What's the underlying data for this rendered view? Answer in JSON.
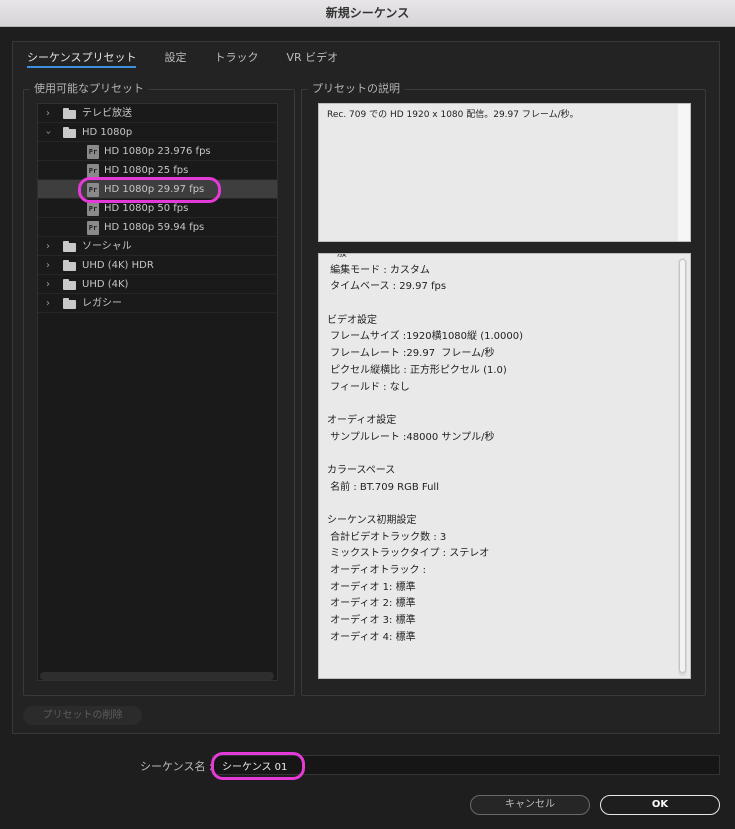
{
  "window": {
    "title": "新規シーケンス"
  },
  "tabs": [
    {
      "label": "シーケンスプリセット",
      "active": true
    },
    {
      "label": "設定",
      "active": false
    },
    {
      "label": "トラック",
      "active": false
    },
    {
      "label": "VR ビデオ",
      "active": false
    }
  ],
  "presets": {
    "group_label": "使用可能なプリセット",
    "tree": [
      {
        "label": "テレビ放送",
        "kind": "folder",
        "expanded": false
      },
      {
        "label": "HD 1080p",
        "kind": "folder",
        "expanded": true
      },
      {
        "label": "HD 1080p 23.976 fps",
        "kind": "preset"
      },
      {
        "label": "HD 1080p 25 fps",
        "kind": "preset"
      },
      {
        "label": "HD 1080p 29.97 fps",
        "kind": "preset",
        "selected": true
      },
      {
        "label": "HD 1080p 50 fps",
        "kind": "preset"
      },
      {
        "label": "HD 1080p 59.94 fps",
        "kind": "preset"
      },
      {
        "label": "ソーシャル",
        "kind": "folder",
        "expanded": false
      },
      {
        "label": "UHD (4K) HDR",
        "kind": "folder",
        "expanded": false
      },
      {
        "label": "UHD (4K)",
        "kind": "folder",
        "expanded": false
      },
      {
        "label": "レガシー",
        "kind": "folder",
        "expanded": false
      }
    ],
    "preset_icon_text": "Pr"
  },
  "description": {
    "group_label": "プリセットの説明",
    "text": "Rec. 709 での HD 1920 x 1080 配信。29.97 フレーム/秒。"
  },
  "details": {
    "lines": [
      "一般",
      " 編集モード : カスタム",
      " タイムベース : 29.97 fps",
      "",
      "ビデオ設定",
      " フレームサイズ :1920横1080縦 (1.0000)",
      " フレームレート :29.97  フレーム/秒",
      " ピクセル縦横比 : 正方形ピクセル (1.0)",
      " フィールド : なし",
      "",
      "オーディオ設定",
      " サンプルレート :48000 サンプル/秒",
      "",
      "カラースペース",
      " 名前 : BT.709 RGB Full",
      "",
      "シーケンス初期設定",
      " 合計ビデオトラック数 : 3",
      " ミックストラックタイプ : ステレオ",
      " オーディオトラック :",
      " オーディオ 1: 標準",
      " オーディオ 2: 標準",
      " オーディオ 3: 標準",
      " オーディオ 4: 標準"
    ]
  },
  "buttons": {
    "delete_preset": "プリセットの削除",
    "cancel": "キャンセル",
    "ok": "OK"
  },
  "sequence": {
    "label": "シーケンス名 :",
    "value": "シーケンス 01"
  },
  "colors": {
    "accent": "#3d8fe0",
    "highlight": "#e63ad8"
  }
}
